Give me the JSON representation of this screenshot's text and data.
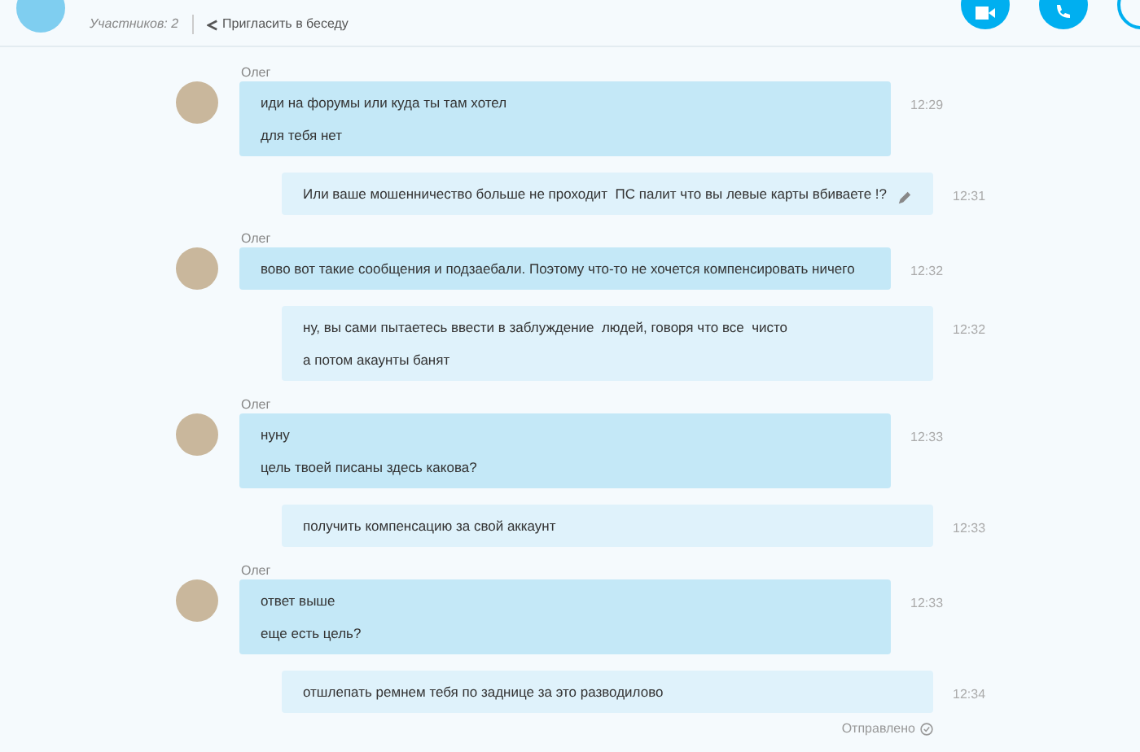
{
  "header": {
    "participants": "Участников: 2",
    "invite": "Пригласить в беседу"
  },
  "messages": [
    {
      "kind": "incoming",
      "sender": "Олег",
      "lines": [
        "иди на форумы или куда ты там хотел",
        "для тебя нет"
      ],
      "time": "12:29",
      "edited": false
    },
    {
      "kind": "outgoing",
      "lines": [
        "Или ваше мошенничество больше не проходит  ПС палит что вы левые карты вбиваете !?"
      ],
      "time": "12:31",
      "edited": true
    },
    {
      "kind": "incoming",
      "sender": "Олег",
      "lines": [
        "вово вот такие сообщения и подзаебали. Поэтому что-то не хочется компенсировать ничего"
      ],
      "time": "12:32",
      "edited": false
    },
    {
      "kind": "outgoing",
      "lines": [
        "ну, вы сами пытаетесь ввести в заблуждение  людей, говоря что все  чисто",
        "а потом акаунты банят"
      ],
      "time": "12:32",
      "edited": false
    },
    {
      "kind": "incoming",
      "sender": "Олег",
      "lines": [
        "нуну",
        "цель твоей писаны здесь какова?"
      ],
      "time": "12:33",
      "edited": false
    },
    {
      "kind": "outgoing",
      "lines": [
        "получить компенсацию за свой аккаунт"
      ],
      "time": "12:33",
      "edited": false
    },
    {
      "kind": "incoming",
      "sender": "Олег",
      "lines": [
        "ответ выше",
        "еще есть цель?"
      ],
      "time": "12:33",
      "edited": false
    },
    {
      "kind": "outgoing",
      "lines": [
        "отшлепать ремнем тебя по заднице за это разводилово"
      ],
      "time": "12:34",
      "edited": false
    }
  ],
  "status": "Отправлено"
}
